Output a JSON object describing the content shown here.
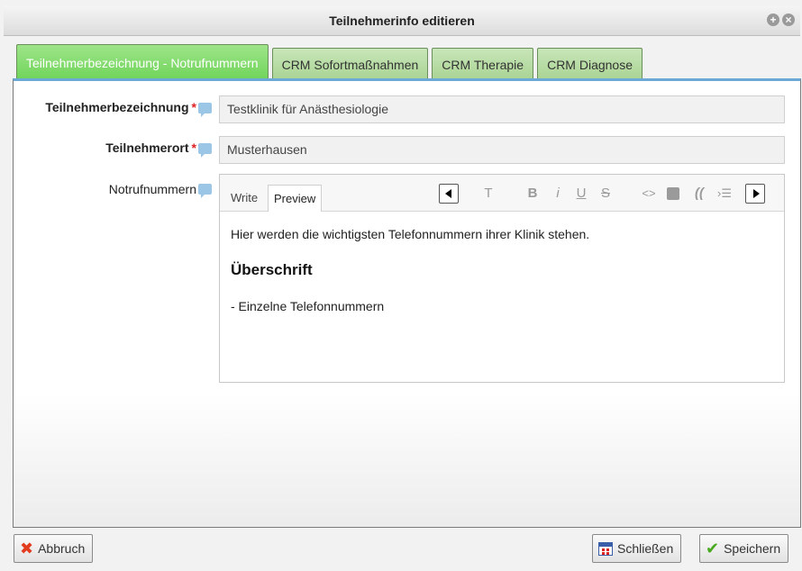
{
  "dialog": {
    "title": "Teilnehmerinfo editieren",
    "title_icons": [
      "plus-icon",
      "close-icon"
    ]
  },
  "tabs": [
    {
      "label": "Teilnehmerbezeichnung - Notrufnummern",
      "active": true
    },
    {
      "label": "CRM Sofortmaßnahmen",
      "active": false
    },
    {
      "label": "CRM Therapie",
      "active": false
    },
    {
      "label": "CRM Diagnose",
      "active": false
    }
  ],
  "form": {
    "bezeichnung": {
      "label": "Teilnehmerbezeichnung",
      "required_mark": "*",
      "value": "Testklinik für Anästhesiologie"
    },
    "ort": {
      "label": "Teilnehmerort",
      "required_mark": "*",
      "value": "Musterhausen"
    },
    "notruf": {
      "label": "Notrufnummern"
    }
  },
  "editor": {
    "tab_write": "Write",
    "tab_preview": "Preview",
    "toolbar": {
      "heading": "T",
      "bold": "B",
      "italic": "i",
      "underline": "U",
      "strike": "S",
      "code": "<>",
      "quote": "((",
      "indent": "›☰"
    },
    "preview": {
      "paragraph": "Hier werden die wichtigsten Telefonnummern ihrer Klinik stehen.",
      "heading": "Überschrift",
      "list_item": "- Einzelne Telefonnummern"
    }
  },
  "buttons": {
    "cancel": "Abbruch",
    "close": "Schließen",
    "save": "Speichern"
  },
  "colors": {
    "active_tab": "#6fd45a",
    "inactive_tab": "#a9d393",
    "panel_top_border": "#6ca9d6",
    "required": "#dd2222"
  }
}
